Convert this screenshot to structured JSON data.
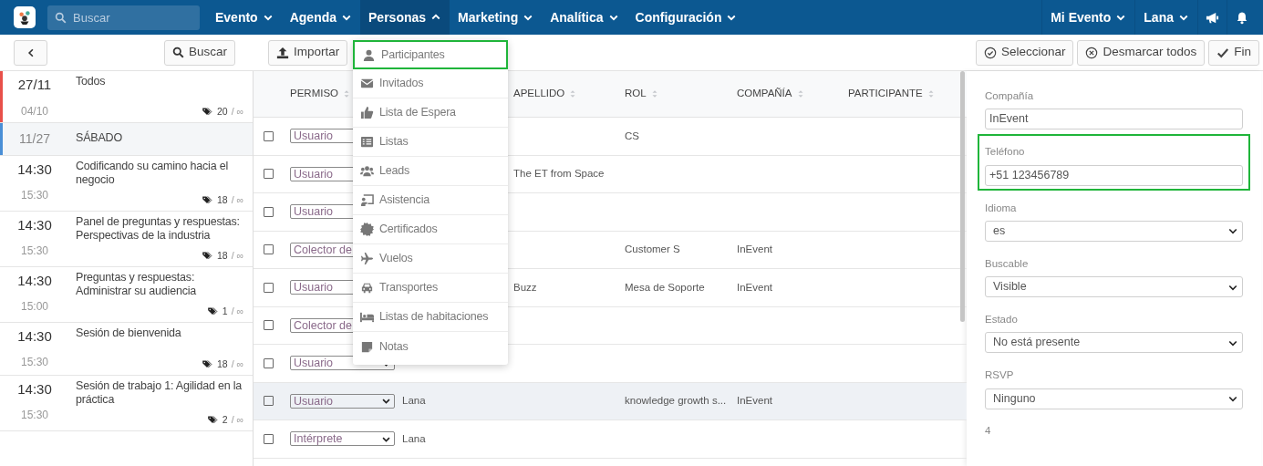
{
  "nav": {
    "search_placeholder": "Buscar",
    "menus": [
      {
        "label": "Evento",
        "expanded": false
      },
      {
        "label": "Agenda",
        "expanded": false
      },
      {
        "label": "Personas",
        "expanded": true
      },
      {
        "label": "Marketing",
        "expanded": false
      },
      {
        "label": "Analítica",
        "expanded": false
      },
      {
        "label": "Configuración",
        "expanded": false
      }
    ],
    "right_menus": [
      {
        "label": "Mi Evento"
      },
      {
        "label": "Lana"
      }
    ]
  },
  "toolbar": {
    "search_button": "Buscar",
    "import_button": "Importar",
    "actions": [
      "Seleccionar",
      "Desmarcar todos",
      "Fin"
    ]
  },
  "sessions": [
    {
      "kind": "day",
      "start": "27/11",
      "end": "04/10",
      "title": "Todos",
      "tag_count": "20",
      "tag_limit": "/ ∞",
      "color": "#e8504a"
    },
    {
      "kind": "header",
      "start": "11/27",
      "title": "SÁBADO",
      "color": "#4a8fd6"
    },
    {
      "kind": "session",
      "start": "14:30",
      "end": "15:30",
      "title": "Codificando su camino hacia el negocio",
      "tag_count": "18",
      "tag_limit": "/ ∞"
    },
    {
      "kind": "session",
      "start": "14:30",
      "end": "15:30",
      "title": "Panel de preguntas y respuestas: Perspectivas de la industria",
      "tag_count": "18",
      "tag_limit": "/ ∞"
    },
    {
      "kind": "session",
      "start": "14:30",
      "end": "15:00",
      "title": "Preguntas y respuestas: Administrar su audiencia",
      "tag_count": "1",
      "tag_limit": "/ ∞"
    },
    {
      "kind": "session",
      "start": "14:30",
      "end": "15:30",
      "title": "Sesión de bienvenida",
      "tag_count": "18",
      "tag_limit": "/ ∞"
    },
    {
      "kind": "session",
      "start": "14:30",
      "end": "15:30",
      "title": "Sesión de trabajo 1: Agilidad en la práctica",
      "tag_count": "2",
      "tag_limit": "/ ∞"
    }
  ],
  "table": {
    "columns": [
      {
        "label": "PERMISO"
      },
      {
        "label": "APELLIDO"
      },
      {
        "label": "ROL"
      },
      {
        "label": "COMPAÑÍA"
      },
      {
        "label": "PARTICIPANTE"
      }
    ],
    "rows": [
      {
        "checked": false,
        "selected": false,
        "permission": "Usuario",
        "role": "CS"
      },
      {
        "checked": false,
        "selected": false,
        "permission": "Usuario",
        "last_name": "The ET from Space"
      },
      {
        "checked": false,
        "selected": false,
        "permission": "Usuario"
      },
      {
        "checked": false,
        "selected": false,
        "permission": "Colector de",
        "role": "Customer S",
        "company": "InEvent"
      },
      {
        "checked": false,
        "selected": false,
        "permission": "Usuario",
        "last_name": "Buzz",
        "role": "Mesa de Soporte",
        "company": "InEvent"
      },
      {
        "checked": false,
        "selected": false,
        "permission": "Colector de"
      },
      {
        "checked": false,
        "selected": false,
        "permission": "Usuario"
      },
      {
        "checked": false,
        "selected": true,
        "permission": "Usuario",
        "column_3": "Lana",
        "role": "knowledge growth s...",
        "company": "InEvent"
      },
      {
        "checked": false,
        "selected": false,
        "permission": "Intérprete",
        "column_3": "Lana"
      }
    ]
  },
  "people_menu": [
    {
      "label": "Participantes",
      "selected": true
    },
    {
      "label": "Invitados",
      "selected": false
    },
    {
      "label": "Lista de Espera",
      "selected": false
    },
    {
      "label": "Listas",
      "selected": false
    },
    {
      "label": "Leads",
      "selected": false
    },
    {
      "label": "Asistencia",
      "selected": false
    },
    {
      "label": "Certificados",
      "selected": false
    },
    {
      "label": "Vuelos",
      "selected": false
    },
    {
      "label": "Transportes",
      "selected": false
    },
    {
      "label": "Listas de habitaciones",
      "selected": false
    },
    {
      "label": "Notas",
      "selected": false
    }
  ],
  "detail": {
    "fields": [
      {
        "kind": "input",
        "label": "Compañía",
        "value": "InEvent",
        "highlighted": false
      },
      {
        "kind": "input",
        "label": "Teléfono",
        "value": "+51 123456789",
        "highlighted": true
      },
      {
        "kind": "select",
        "label": "Idioma",
        "value": "es",
        "highlighted": false
      },
      {
        "kind": "select",
        "label": "Buscable",
        "value": "Visible",
        "highlighted": false
      },
      {
        "kind": "select",
        "label": "Estado",
        "value": "No está presente",
        "highlighted": false
      },
      {
        "kind": "select",
        "label": "RSVP",
        "value": "Ninguno",
        "highlighted": false
      }
    ],
    "next_label": "4"
  }
}
